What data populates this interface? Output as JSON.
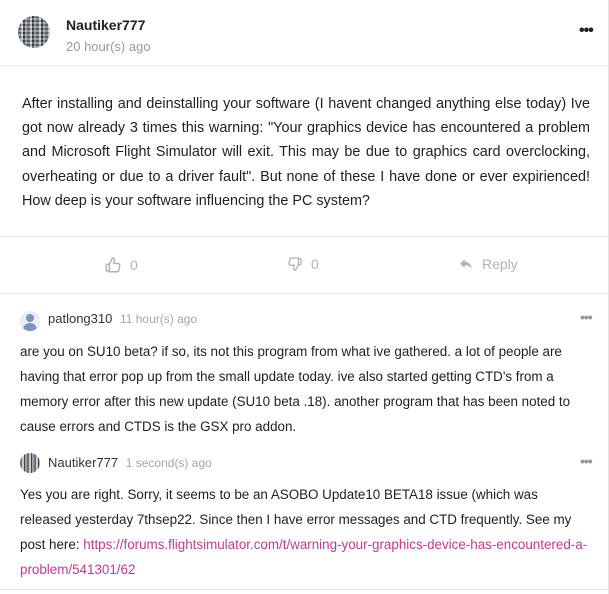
{
  "post": {
    "author": "Nautiker777",
    "time": "20 hour(s) ago",
    "more_icon": "ellipsis-icon",
    "more_label": "•••",
    "body": "After installing and deinstalling your software (I havent changed anything else today) Ive got now already 3 times this warning: \"Your graphics device has encountered a problem and Microsoft Flight Simulator will exit. This may be due to graphics card overclocking, overheating or due to a driver fault\". But none of these I have done or ever expirienced! How deep is your software influencing the PC system?",
    "likes": "0",
    "dislikes": "0",
    "reply_label": "Reply"
  },
  "comments": [
    {
      "author": "patlong310",
      "time": "11 hour(s) ago",
      "more_label": "•••",
      "body": "are you on SU10 beta? if so, its not this program from what ive gathered. a lot of people are having that error pop up from the small update today. ive also started getting CTD's from a memory error after this new update (SU10 beta .18). another program that has been noted to cause errors and CTDS is the GSX pro addon."
    },
    {
      "author": "Nautiker777",
      "time": "1 second(s) ago",
      "more_label": "•••",
      "body": "Yes you are right. Sorry, it seems to be an ASOBO Update10 BETA18 issue (which was released yesterday 7thsep22. Since then I have error messages and CTD frequently. See my post here: ",
      "link_text": "https://forums.flightsimulator.com/t/warning-your-graphics-device-has-encountered-a-problem/541301/62"
    }
  ],
  "colors": {
    "link": "#c2399b",
    "muted": "#9a9a9a",
    "border": "#ececec"
  }
}
